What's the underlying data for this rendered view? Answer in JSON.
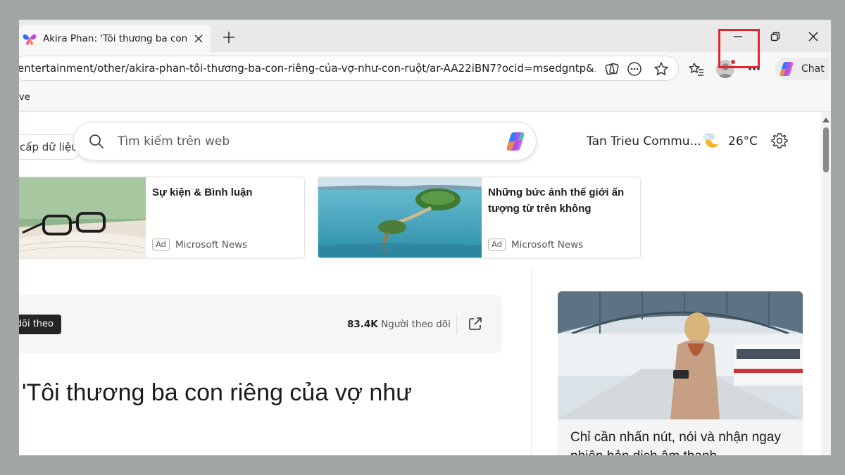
{
  "browser": {
    "tab": {
      "title": "Akira Phan: 'Tôi thương ba con riêng"
    },
    "address": {
      "url": "/entertainment/other/akira-phan-tôi-thương-ba-con-riêng-của-vợ-như-con-ruột/ar-AA22iBN7?ocid=msedgntp&..."
    },
    "chat_label": "Chat",
    "favorites_fragment": "ve"
  },
  "page": {
    "data_pill": "cấp dữ liệu",
    "search": {
      "placeholder": "Tìm kiếm trên web"
    },
    "weather": {
      "location": "Tan Trieu Commu...",
      "temperature": "26°C"
    },
    "cards": [
      {
        "title": "Sự kiện & Bình luận",
        "ad": "Ad",
        "source": "Microsoft News"
      },
      {
        "title": "Những bức ảnh thế giới ấn tượng từ trên không",
        "ad": "Ad",
        "source": "Microsoft News"
      }
    ],
    "follow": {
      "button": "dõi theo",
      "count": "83.4K",
      "count_label": "Người theo dõi"
    },
    "headline": "'Tôi thương ba con riêng của vợ như",
    "promo": {
      "text": "Chỉ cần nhấn nút, nói và nhận ngay phiên bản dịch âm thanh"
    }
  },
  "colors": {
    "highlight": "#e2262f",
    "follow_button": "#242424"
  }
}
